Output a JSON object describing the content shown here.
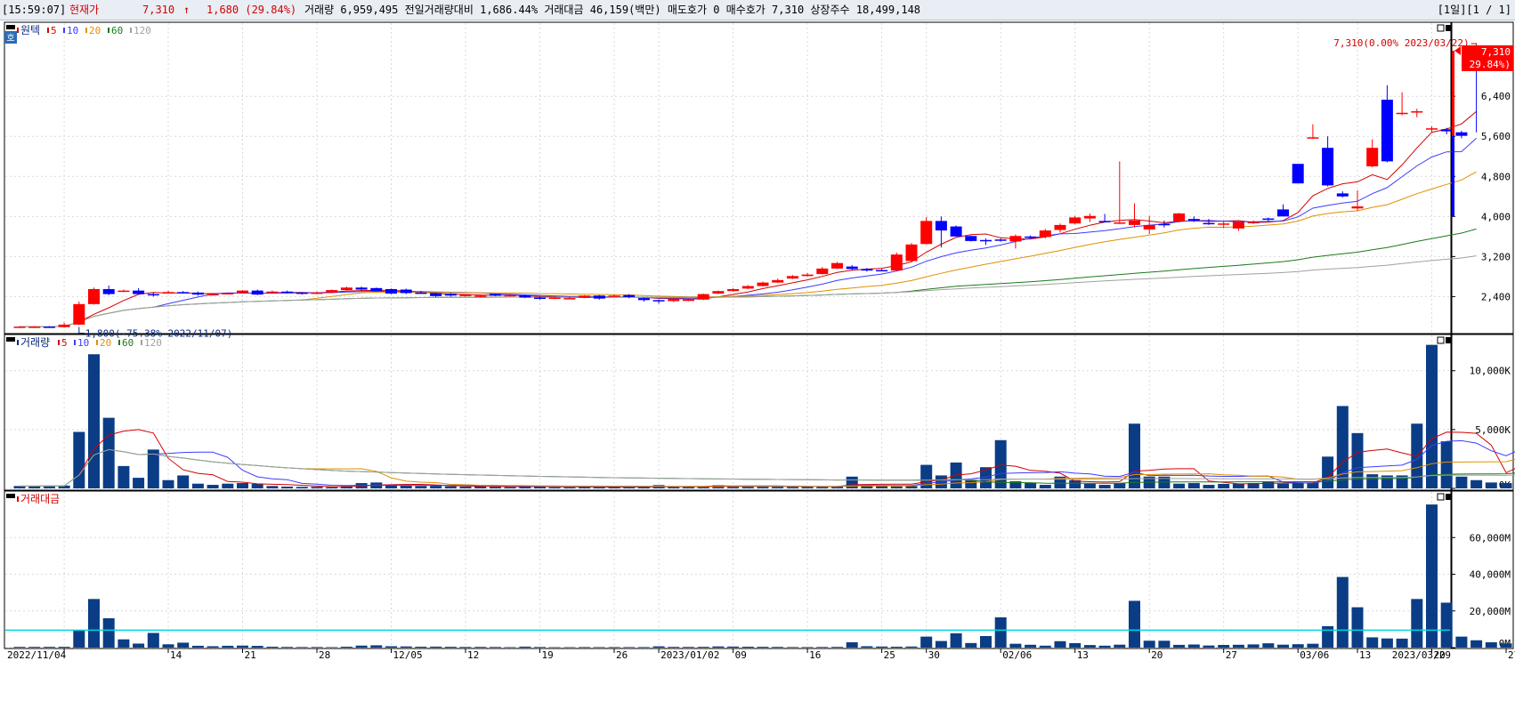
{
  "header": {
    "time": "[15:59:07]",
    "price_label": "현재가",
    "price": "7,310",
    "arrow": "↑",
    "change": "1,680 (29.84%)",
    "info": "거래량 6,959,495  전일거래량대비 1,686.44%  거래대금 46,159(백만)  매도호가 0  매수호가 7,310  상장주수 18,499,148",
    "page": "[1일][1 / 1]"
  },
  "colors": {
    "up": "#ff0000",
    "down": "#0000ff",
    "ma5": "#d40000",
    "ma10": "#3c3cff",
    "ma20": "#e09000",
    "ma60": "#1a7a1a",
    "ma120": "#a0a0a0",
    "vol_bar": "#0b3d86",
    "ref_line": "#00d8e0",
    "header_up": "#d40000"
  },
  "panels": {
    "price": {
      "title_marker": "호",
      "title": "원텍",
      "legend": [
        {
          "label": "5",
          "color": "#d40000"
        },
        {
          "label": "10",
          "color": "#3c3cff"
        },
        {
          "label": "20",
          "color": "#e09000"
        },
        {
          "label": "60",
          "color": "#1a7a1a"
        },
        {
          "label": "120",
          "color": "#a0a0a0"
        }
      ],
      "yticks": [
        "6,400",
        "5,600",
        "4,800",
        "4,000",
        "3,200",
        "2,400"
      ],
      "last_price_tag": "7,310",
      "last_change_tag": "( 29.84%)",
      "high_annotation": "7,310(0.00% 2023/03/22)",
      "low_annotation": "1,800(-75.38% 2022/11/07)"
    },
    "volume": {
      "title": "거래량",
      "legend": [
        {
          "label": "5",
          "color": "#d40000"
        },
        {
          "label": "10",
          "color": "#3c3cff"
        },
        {
          "label": "20",
          "color": "#e09000"
        },
        {
          "label": "60",
          "color": "#1a7a1a"
        },
        {
          "label": "120",
          "color": "#a0a0a0"
        }
      ],
      "yticks": [
        "10,000K",
        "5,000K",
        "0K"
      ]
    },
    "amount": {
      "title": "거래대금",
      "yticks": [
        "60,000M",
        "40,000M",
        "20,000M",
        "0M"
      ]
    }
  },
  "xaxis": {
    "labels": [
      "2022/11/04",
      "14",
      "21",
      "28",
      "12/05",
      "12",
      "19",
      "26",
      "2023/01/02",
      "09",
      "16",
      "25",
      "30",
      "02/06",
      "13",
      "20",
      "27",
      "03/06",
      "13",
      "20",
      "27",
      "2023/03/29"
    ]
  },
  "chart_data": {
    "type": "candlestick",
    "title": "원텍",
    "dates": [
      "2022-11-01",
      "2022-11-02",
      "2022-11-03",
      "2022-11-04",
      "2022-11-07",
      "2022-11-08",
      "2022-11-09",
      "2022-11-10",
      "2022-11-11",
      "2022-11-14",
      "2022-11-15",
      "2022-11-16",
      "2022-11-17",
      "2022-11-18",
      "2022-11-21",
      "2022-11-22",
      "2022-11-23",
      "2022-11-24",
      "2022-11-25",
      "2022-11-28",
      "2022-11-29",
      "2022-11-30",
      "2022-12-01",
      "2022-12-02",
      "2022-12-05",
      "2022-12-06",
      "2022-12-07",
      "2022-12-08",
      "2022-12-09",
      "2022-12-12",
      "2022-12-13",
      "2022-12-14",
      "2022-12-15",
      "2022-12-16",
      "2022-12-19",
      "2022-12-20",
      "2022-12-21",
      "2022-12-22",
      "2022-12-23",
      "2022-12-26",
      "2022-12-27",
      "2022-12-28",
      "2022-12-29",
      "2023-01-02",
      "2023-01-03",
      "2023-01-04",
      "2023-01-05",
      "2023-01-06",
      "2023-01-09",
      "2023-01-10",
      "2023-01-11",
      "2023-01-12",
      "2023-01-13",
      "2023-01-16",
      "2023-01-17",
      "2023-01-18",
      "2023-01-19",
      "2023-01-20",
      "2023-01-25",
      "2023-01-26",
      "2023-01-27",
      "2023-01-30",
      "2023-01-31",
      "2023-02-01",
      "2023-02-02",
      "2023-02-03",
      "2023-02-06",
      "2023-02-07",
      "2023-02-08",
      "2023-02-09",
      "2023-02-10",
      "2023-02-13",
      "2023-02-14",
      "2023-02-15",
      "2023-02-16",
      "2023-02-17",
      "2023-02-20",
      "2023-02-21",
      "2023-02-22",
      "2023-02-23",
      "2023-02-24",
      "2023-02-27",
      "2023-02-28",
      "2023-03-02",
      "2023-03-03",
      "2023-03-06",
      "2023-03-07",
      "2023-03-08",
      "2023-03-09",
      "2023-03-10",
      "2023-03-13",
      "2023-03-14",
      "2023-03-15",
      "2023-03-16",
      "2023-03-17",
      "2023-03-20",
      "2023-03-21",
      "2023-03-22"
    ],
    "open": [
      1800,
      1800,
      1800,
      1790,
      1840,
      2250,
      2550,
      2520,
      2520,
      2450,
      2480,
      2490,
      2480,
      2440,
      2450,
      2470,
      2520,
      2490,
      2500,
      2480,
      2470,
      2480,
      2530,
      2580,
      2570,
      2550,
      2540,
      2480,
      2470,
      2460,
      2410,
      2420,
      2450,
      2420,
      2420,
      2380,
      2360,
      2370,
      2380,
      2420,
      2420,
      2430,
      2370,
      2330,
      2310,
      2330,
      2340,
      2460,
      2510,
      2560,
      2610,
      2680,
      2760,
      2810,
      2850,
      2960,
      3000,
      2950,
      2930,
      2920,
      3110,
      3450,
      3910,
      3800,
      3610,
      3530,
      3540,
      3500,
      3600,
      3590,
      3730,
      3860,
      3960,
      3910,
      3880,
      3830,
      3740,
      3850,
      3900,
      3950,
      3870,
      3860,
      3760,
      3890,
      3960,
      4140,
      5050,
      5580,
      5370,
      4460,
      4160,
      5000,
      6330,
      6070,
      6100,
      5750,
      5740,
      5680
    ],
    "close": [
      1800,
      1800,
      1790,
      1840,
      2250,
      2550,
      2450,
      2520,
      2450,
      2440,
      2490,
      2480,
      2440,
      2450,
      2470,
      2520,
      2440,
      2500,
      2480,
      2470,
      2480,
      2530,
      2580,
      2540,
      2510,
      2460,
      2470,
      2470,
      2410,
      2420,
      2440,
      2420,
      2430,
      2430,
      2380,
      2360,
      2380,
      2370,
      2420,
      2360,
      2420,
      2390,
      2330,
      2310,
      2360,
      2340,
      2450,
      2510,
      2550,
      2610,
      2680,
      2730,
      2810,
      2840,
      2960,
      3070,
      2950,
      2920,
      2920,
      3240,
      3440,
      3910,
      3720,
      3600,
      3510,
      3510,
      3530,
      3610,
      3580,
      3720,
      3830,
      3980,
      4010,
      3900,
      3880,
      3920,
      3830,
      3840,
      4060,
      3920,
      3850,
      3860,
      3890,
      3890,
      3940,
      4000,
      4660,
      5580,
      4620,
      4400,
      4200,
      5370,
      5100,
      6070,
      6100,
      5760,
      5700,
      5610,
      7310
    ],
    "high": [
      1810,
      1810,
      1810,
      1880,
      2300,
      2580,
      2620,
      2540,
      2570,
      2480,
      2520,
      2510,
      2500,
      2470,
      2480,
      2530,
      2540,
      2520,
      2520,
      2490,
      2500,
      2540,
      2600,
      2600,
      2580,
      2560,
      2560,
      2510,
      2480,
      2470,
      2450,
      2440,
      2460,
      2450,
      2440,
      2400,
      2400,
      2400,
      2430,
      2430,
      2440,
      2450,
      2380,
      2340,
      2370,
      2360,
      2460,
      2520,
      2570,
      2630,
      2700,
      2760,
      2830,
      2870,
      2990,
      3090,
      3030,
      2970,
      2950,
      3280,
      3470,
      3990,
      4000,
      3820,
      3620,
      3560,
      3560,
      3640,
      3620,
      3750,
      3860,
      4010,
      4060,
      4050,
      5100,
      4260,
      4010,
      3920,
      4070,
      4000,
      3950,
      3910,
      3900,
      3920,
      3980,
      4240,
      4800,
      5840,
      5600,
      4500,
      4520,
      5540,
      6620,
      6480,
      6150,
      5800,
      5770,
      5710,
      7310
    ],
    "low": [
      1790,
      1790,
      1780,
      1780,
      1830,
      2240,
      2430,
      2490,
      2440,
      2400,
      2460,
      2460,
      2420,
      2420,
      2440,
      2460,
      2430,
      2470,
      2460,
      2440,
      2450,
      2470,
      2520,
      2520,
      2500,
      2450,
      2450,
      2460,
      2390,
      2400,
      2400,
      2390,
      2410,
      2400,
      2370,
      2340,
      2350,
      2350,
      2370,
      2340,
      2400,
      2370,
      2300,
      2260,
      2290,
      2310,
      2330,
      2450,
      2500,
      2550,
      2600,
      2670,
      2750,
      2800,
      2840,
      2950,
      2930,
      2900,
      2910,
      2910,
      3100,
      3440,
      3380,
      3600,
      3500,
      3430,
      3500,
      3360,
      3570,
      3560,
      3680,
      3840,
      3890,
      3880,
      3850,
      3780,
      3650,
      3780,
      3880,
      3890,
      3830,
      3770,
      3710,
      3850,
      3900,
      4110,
      5000,
      5550,
      4600,
      4380,
      4120,
      4980,
      5080,
      6020,
      5980,
      5680,
      5640,
      5560,
      5680
    ],
    "volume_k": [
      200,
      200,
      220,
      240,
      4800,
      11400,
      6000,
      1900,
      900,
      3300,
      700,
      1100,
      400,
      300,
      400,
      450,
      380,
      200,
      150,
      130,
      130,
      100,
      200,
      450,
      500,
      300,
      260,
      200,
      220,
      180,
      150,
      160,
      140,
      100,
      220,
      140,
      90,
      90,
      120,
      110,
      120,
      110,
      120,
      280,
      160,
      150,
      170,
      260,
      230,
      200,
      180,
      160,
      120,
      120,
      140,
      160,
      1000,
      250,
      200,
      170,
      200,
      2000,
      1100,
      2200,
      700,
      1800,
      4100,
      600,
      450,
      300,
      1000,
      700,
      400,
      300,
      450,
      5500,
      1000,
      1000,
      400,
      450,
      300,
      380,
      400,
      450,
      600,
      400,
      450,
      500,
      2700,
      7000,
      4700,
      1200,
      1100,
      1100,
      5500,
      12200,
      4000,
      1000,
      700,
      500,
      450,
      6900
    ],
    "amount_m": [
      400,
      400,
      420,
      450,
      9500,
      26500,
      16000,
      4500,
      2200,
      8000,
      1800,
      2700,
      1000,
      750,
      1000,
      1100,
      950,
      500,
      380,
      320,
      330,
      250,
      500,
      1100,
      1250,
      750,
      650,
      500,
      550,
      450,
      380,
      400,
      350,
      250,
      550,
      350,
      230,
      230,
      300,
      270,
      300,
      280,
      300,
      700,
      400,
      380,
      430,
      650,
      580,
      500,
      450,
      400,
      300,
      300,
      350,
      400,
      2900,
      750,
      600,
      500,
      600,
      6000,
      3600,
      7800,
      2500,
      6300,
      16500,
      2100,
      1550,
      1050,
      3500,
      2450,
      1400,
      1050,
      1600,
      25500,
      3750,
      3750,
      1500,
      1700,
      1150,
      1450,
      1550,
      1750,
      2350,
      1600,
      1850,
      2100,
      11700,
      38500,
      22000,
      5600,
      5000,
      4900,
      26500,
      78000,
      24500,
      6000,
      4000,
      2900,
      2300,
      46159
    ],
    "price_ylim": [
      1750,
      7700
    ],
    "volume_ylim": [
      0,
      12400
    ],
    "amount_ylim": [
      0,
      80000
    ],
    "amount_ref_line": 9500,
    "last": {
      "price": 7310,
      "change": 1680,
      "change_pct": 29.84
    }
  }
}
